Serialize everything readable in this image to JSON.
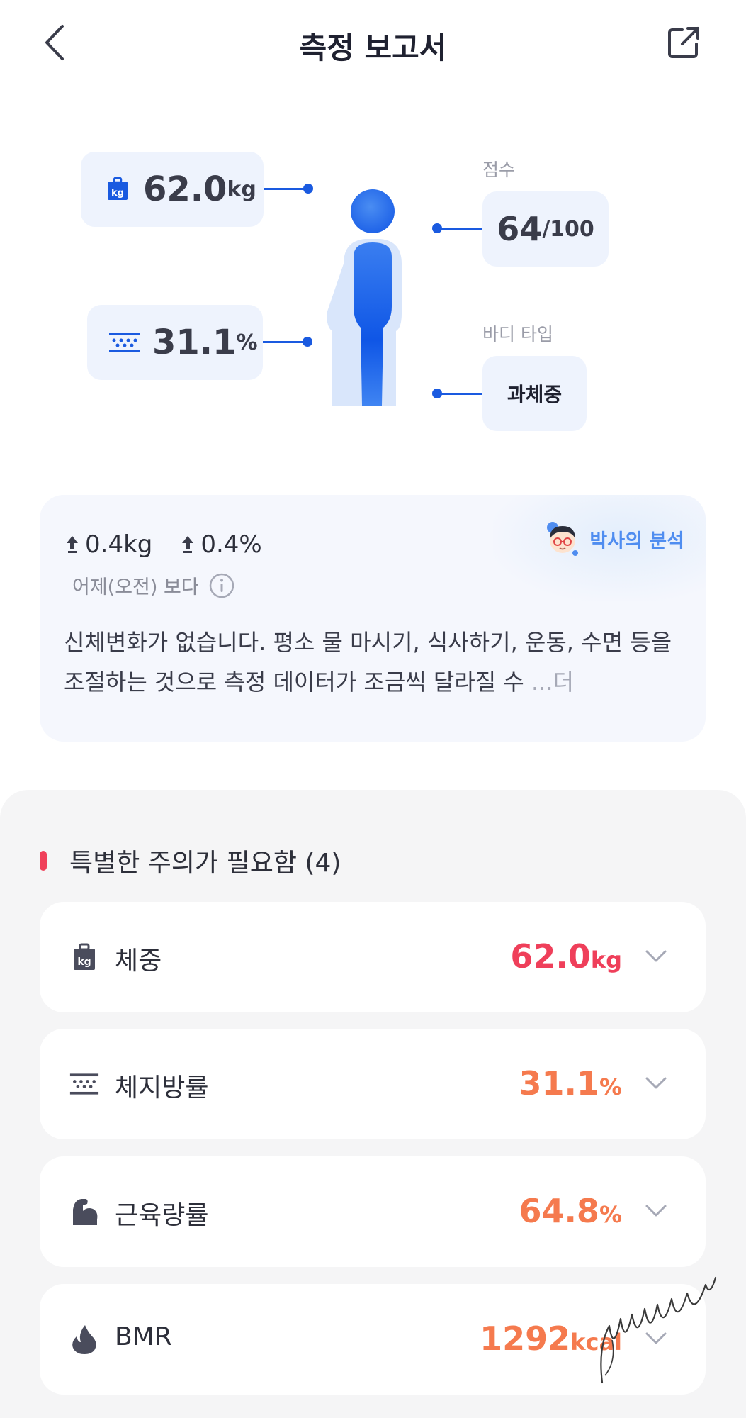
{
  "header": {
    "title": "측정 보고서"
  },
  "summary": {
    "weight": {
      "value": "62.0",
      "unit": "kg"
    },
    "body_fat": {
      "value": "31.1",
      "unit": "%"
    },
    "score": {
      "label": "점수",
      "value": "64",
      "max": "/100"
    },
    "body_type": {
      "label": "바디 타입",
      "value": "과체중"
    }
  },
  "analysis": {
    "weight_change": "0.4kg",
    "fat_change": "0.4%",
    "compare_label": "어제(오전) 보다",
    "doctor_label": "박사의 분석",
    "text": "신체변화가 없습니다. 평소 물 마시기, 식사하기, 운동, 수면 등을 조절하는 것으로 측정 데이터가 조금씩 달라질 수 ",
    "more": "...더"
  },
  "attention": {
    "title": "특별한 주의가 필요함 (4)",
    "items": [
      {
        "icon": "weight-icon",
        "name": "체중",
        "value": "62.0",
        "unit": "kg",
        "color": "#ef3f5a"
      },
      {
        "icon": "body-fat-icon",
        "name": "체지방률",
        "value": "31.1",
        "unit": "%",
        "color": "#f57a4e"
      },
      {
        "icon": "muscle-icon",
        "name": "근육량률",
        "value": "64.8",
        "unit": "%",
        "color": "#f57a4e"
      },
      {
        "icon": "flame-icon",
        "name": "BMR",
        "value": "1292",
        "unit": "kcal",
        "color": "#f57a4e"
      }
    ]
  },
  "colors": {
    "accent": "#1a5ae0",
    "warning_red": "#ef3f5a",
    "warning_orange": "#f57a4e"
  }
}
